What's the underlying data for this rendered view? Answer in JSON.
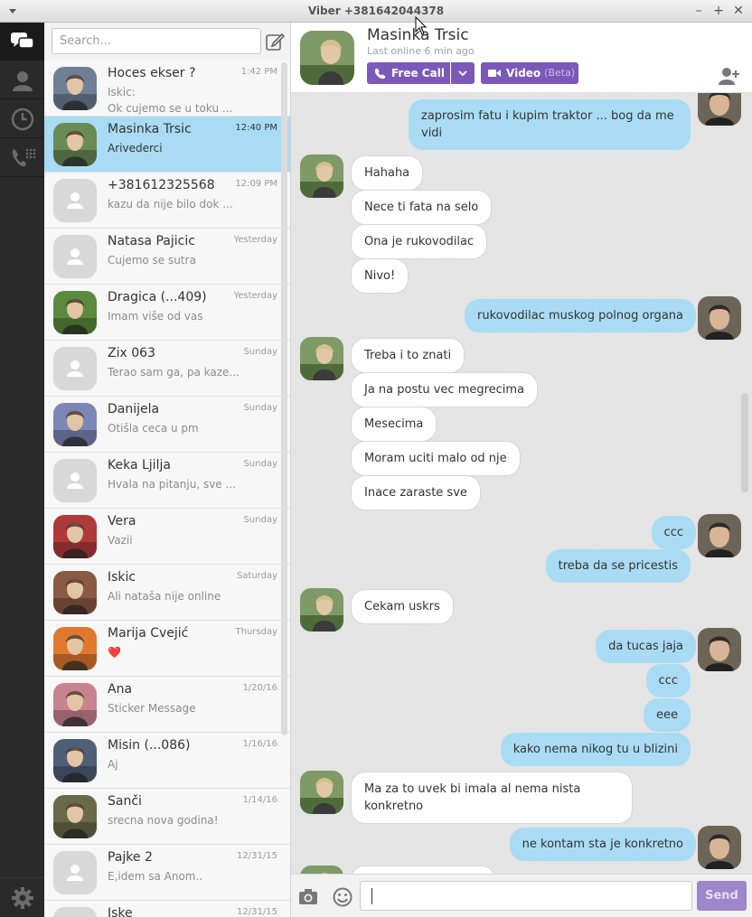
{
  "window": {
    "title": "Viber +381642044378",
    "min": "–",
    "max": "+",
    "close": "✕"
  },
  "search": {
    "placeholder": "Search..."
  },
  "conversations": [
    {
      "name": "Hoces ekser ?",
      "time": "1:42 PM",
      "line1": "Iskic:",
      "line2": "Ok cujemo se u toku ...",
      "avatar": "photo",
      "tone": "#6e7f96"
    },
    {
      "name": "Masinka Trsic",
      "time": "12:40 PM",
      "line1": "Arivederci",
      "line2": "",
      "avatar": "photo",
      "tone": "#6a8a56",
      "active": true
    },
    {
      "name": "+381612325568",
      "time": "12:09 PM",
      "line1": "kazu da nije bilo dok ...",
      "line2": "",
      "avatar": "default"
    },
    {
      "name": "Natasa Pajicic",
      "time": "Yesterday",
      "line1": "Cujemo se sutra",
      "line2": "",
      "avatar": "default"
    },
    {
      "name": "Dragica (...409)",
      "time": "Yesterday",
      "line1": "Imam više od vas",
      "line2": "",
      "avatar": "photo",
      "tone": "#5a8a3e"
    },
    {
      "name": "Zix 063",
      "time": "Sunday",
      "line1": "Terao sam ga, pa kaze...",
      "line2": "",
      "avatar": "default"
    },
    {
      "name": "Danijela",
      "time": "Sunday",
      "line1": "Otišla ceca u pm",
      "line2": "",
      "avatar": "photo",
      "tone": "#7b86b5"
    },
    {
      "name": "Keka Ljilja",
      "time": "Sunday",
      "line1": "Hvala na pitanju,  sve ...",
      "line2": "",
      "avatar": "default"
    },
    {
      "name": "Vera",
      "time": "Sunday",
      "line1": "Vazii",
      "line2": "",
      "avatar": "photo",
      "tone": "#b03a3a"
    },
    {
      "name": "Iskic",
      "time": "Saturday",
      "line1": "Ali nataša  nije online",
      "line2": "",
      "avatar": "photo",
      "tone": "#8b5a45"
    },
    {
      "name": "Marija Cvejić",
      "time": "Thursday",
      "line1": "❤️",
      "line2": "",
      "avatar": "photo",
      "tone": "#e07830"
    },
    {
      "name": "Ana",
      "time": "1/20/16",
      "line1": "Sticker Message",
      "line2": "",
      "avatar": "photo",
      "tone": "#c9838f"
    },
    {
      "name": "Misin (...086)",
      "time": "1/16/16",
      "line1": "Aj",
      "line2": "",
      "avatar": "photo",
      "tone": "#4e5f78"
    },
    {
      "name": "Sanči",
      "time": "1/14/16",
      "line1": "srecna nova godina!",
      "line2": "",
      "avatar": "photo",
      "tone": "#6a6a4a"
    },
    {
      "name": "Pajke 2",
      "time": "12/31/15",
      "line1": "E,idem sa Anom..",
      "line2": "",
      "avatar": "default"
    },
    {
      "name": "Iske",
      "time": "12/31/15",
      "line1": "",
      "line2": "",
      "avatar": "default"
    }
  ],
  "chat": {
    "name": "Masinka Trsic",
    "status": "Last online 6 min ago",
    "call_label": "Free Call",
    "video_label": "Video",
    "video_beta": "(Beta)",
    "send_label": "Send",
    "messages": [
      {
        "dir": "out",
        "text": "zaprosim fatu i kupim traktor ... bog da me vidi"
      },
      {
        "dir": "in",
        "text": "Hahaha"
      },
      {
        "dir": "in",
        "text": "Nece ti fata na selo"
      },
      {
        "dir": "in",
        "text": "Ona je rukovodilac"
      },
      {
        "dir": "in",
        "text": "Nivo!"
      },
      {
        "dir": "out",
        "text": "rukovodilac muskog polnog organa"
      },
      {
        "dir": "in",
        "text": "Treba i to znati"
      },
      {
        "dir": "in",
        "text": "Ja na postu vec megrecima"
      },
      {
        "dir": "in",
        "text": "Mesecima"
      },
      {
        "dir": "in",
        "text": "Moram uciti malo od nje"
      },
      {
        "dir": "in",
        "text": "Inace zaraste sve"
      },
      {
        "dir": "out",
        "text": "ccc"
      },
      {
        "dir": "out",
        "text": "treba da se pricestis"
      },
      {
        "dir": "in",
        "text": "Cekam uskrs"
      },
      {
        "dir": "out",
        "text": "da tucas jaja"
      },
      {
        "dir": "out",
        "text": "ccc"
      },
      {
        "dir": "out",
        "text": "eee"
      },
      {
        "dir": "out",
        "text": "kako nema nikog tu u blizini"
      },
      {
        "dir": "in",
        "text": "Ma za to uvek bi  imala al nema nista konkretno"
      },
      {
        "dir": "out",
        "text": "ne kontam sta je konkretno"
      }
    ]
  }
}
